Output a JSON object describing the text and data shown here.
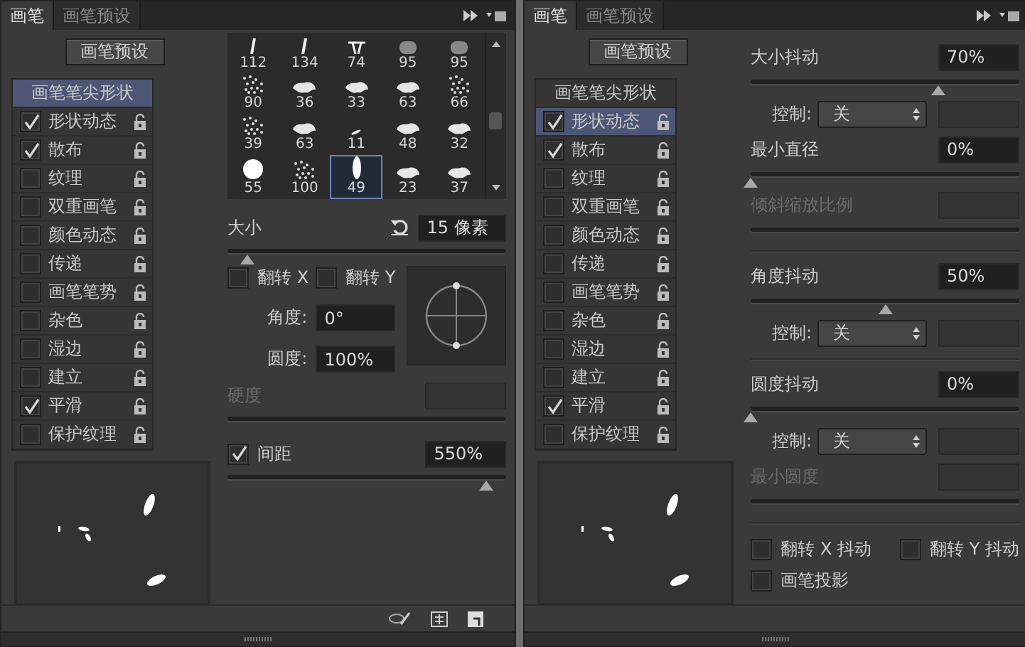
{
  "panels": [
    {
      "tabs": [
        {
          "label": "画笔",
          "selected": true
        },
        {
          "label": "画笔预设",
          "selected": false
        }
      ],
      "preset_button": "画笔预设",
      "options": [
        {
          "kind": "header",
          "label": "画笔笔尖形状",
          "selected": true
        },
        {
          "kind": "option",
          "label": "形状动态",
          "checked": true,
          "selected": false
        },
        {
          "kind": "option",
          "label": "散布",
          "checked": true,
          "selected": false
        },
        {
          "kind": "option",
          "label": "纹理",
          "checked": false,
          "selected": false
        },
        {
          "kind": "option",
          "label": "双重画笔",
          "checked": false,
          "selected": false
        },
        {
          "kind": "option",
          "label": "颜色动态",
          "checked": false,
          "selected": false
        },
        {
          "kind": "option",
          "label": "传递",
          "checked": false,
          "selected": false
        },
        {
          "kind": "option",
          "label": "画笔笔势",
          "checked": false,
          "selected": false
        },
        {
          "kind": "option",
          "label": "杂色",
          "checked": false,
          "selected": false
        },
        {
          "kind": "option",
          "label": "湿边",
          "checked": false,
          "selected": false
        },
        {
          "kind": "option",
          "label": "建立",
          "checked": false,
          "selected": false
        },
        {
          "kind": "option",
          "label": "平滑",
          "checked": true,
          "selected": false
        },
        {
          "kind": "option",
          "label": "保护纹理",
          "checked": false,
          "selected": false
        }
      ],
      "content": {
        "kind": "tip_shape",
        "brushes": [
          {
            "size": "112",
            "kind": "stroke",
            "selected": false
          },
          {
            "size": "134",
            "kind": "stroke",
            "selected": false
          },
          {
            "size": "74",
            "kind": "bristle",
            "selected": false
          },
          {
            "size": "95",
            "kind": "round-soft",
            "selected": false
          },
          {
            "size": "95",
            "kind": "round-soft",
            "selected": false
          },
          {
            "size": "90",
            "kind": "scatter",
            "selected": false
          },
          {
            "size": "36",
            "kind": "spatter",
            "selected": false
          },
          {
            "size": "33",
            "kind": "spatter",
            "selected": false
          },
          {
            "size": "63",
            "kind": "spatter",
            "selected": false
          },
          {
            "size": "66",
            "kind": "scatter",
            "selected": false
          },
          {
            "size": "39",
            "kind": "scatter",
            "selected": false
          },
          {
            "size": "63",
            "kind": "spatter",
            "selected": false
          },
          {
            "size": "11",
            "kind": "speck",
            "selected": false
          },
          {
            "size": "48",
            "kind": "spatter",
            "selected": false
          },
          {
            "size": "32",
            "kind": "spatter",
            "selected": false
          },
          {
            "size": "55",
            "kind": "round-hard",
            "selected": false
          },
          {
            "size": "100",
            "kind": "scatter",
            "selected": false
          },
          {
            "size": "49",
            "kind": "ellipse",
            "selected": true
          },
          {
            "size": "23",
            "kind": "spatter",
            "selected": false
          },
          {
            "size": "37",
            "kind": "spatter",
            "selected": false
          }
        ],
        "size": {
          "label": "大小",
          "value": "15 像素",
          "level": 0.07
        },
        "flips": [
          {
            "label": "翻转 X",
            "checked": false
          },
          {
            "label": "翻转 Y",
            "checked": false
          }
        ],
        "angle": {
          "label": "角度:",
          "value": "0°"
        },
        "roundness": {
          "label": "圆度:",
          "value": "100%"
        },
        "hardness": {
          "label": "硬度",
          "disabled": true
        },
        "spacing": {
          "label": "间距",
          "checked": true,
          "value": "550%",
          "level": 0.93
        }
      },
      "footer_tools": [
        {
          "kind": "eye-brush"
        },
        {
          "kind": "grid"
        },
        {
          "kind": "new-page"
        }
      ]
    },
    {
      "tabs": [
        {
          "label": "画笔",
          "selected": true
        },
        {
          "label": "画笔预设",
          "selected": false
        }
      ],
      "preset_button": "画笔预设",
      "options": [
        {
          "kind": "header",
          "label": "画笔笔尖形状",
          "selected": false
        },
        {
          "kind": "option",
          "label": "形状动态",
          "checked": true,
          "selected": true
        },
        {
          "kind": "option",
          "label": "散布",
          "checked": true,
          "selected": false
        },
        {
          "kind": "option",
          "label": "纹理",
          "checked": false,
          "selected": false
        },
        {
          "kind": "option",
          "label": "双重画笔",
          "checked": false,
          "selected": false
        },
        {
          "kind": "option",
          "label": "颜色动态",
          "checked": false,
          "selected": false
        },
        {
          "kind": "option",
          "label": "传递",
          "checked": false,
          "selected": false
        },
        {
          "kind": "option",
          "label": "画笔笔势",
          "checked": false,
          "selected": false
        },
        {
          "kind": "option",
          "label": "杂色",
          "checked": false,
          "selected": false
        },
        {
          "kind": "option",
          "label": "湿边",
          "checked": false,
          "selected": false
        },
        {
          "kind": "option",
          "label": "建立",
          "checked": false,
          "selected": false
        },
        {
          "kind": "option",
          "label": "平滑",
          "checked": true,
          "selected": false
        },
        {
          "kind": "option",
          "label": "保护纹理",
          "checked": false,
          "selected": false
        }
      ],
      "content": {
        "kind": "shape_dynamics",
        "groups": [
          [
            {
              "kind": "slider",
              "label": "大小抖动",
              "value": "70%",
              "level": 0.7,
              "disabled": false
            },
            {
              "kind": "control",
              "label": "控制:",
              "value": "关"
            },
            {
              "kind": "slider",
              "label": "最小直径",
              "value": "0%",
              "level": 0,
              "disabled": false
            },
            {
              "kind": "slider",
              "label": "倾斜缩放比例",
              "disabled": true
            }
          ],
          [
            {
              "kind": "slider",
              "label": "角度抖动",
              "value": "50%",
              "level": 0.5,
              "disabled": false
            },
            {
              "kind": "control",
              "label": "控制:",
              "value": "关"
            }
          ],
          [
            {
              "kind": "slider",
              "label": "圆度抖动",
              "value": "0%",
              "level": 0,
              "disabled": false
            },
            {
              "kind": "control",
              "label": "控制:",
              "value": "关"
            },
            {
              "kind": "slider",
              "label": "最小圆度",
              "disabled": true
            }
          ]
        ],
        "checks": [
          {
            "label": "翻转 X 抖动",
            "checked": false
          },
          {
            "label": "翻转 Y 抖动",
            "checked": false
          },
          {
            "label": "画笔投影",
            "checked": false
          }
        ]
      }
    }
  ]
}
